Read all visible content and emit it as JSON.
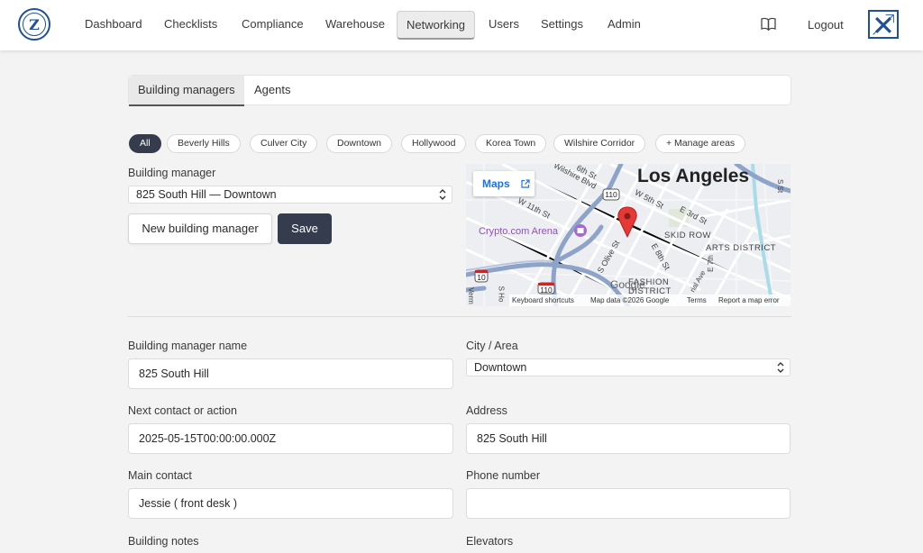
{
  "nav": {
    "logo_letter": "Z",
    "items": [
      "Dashboard",
      "Checklists",
      "Compliance",
      "Warehouse",
      "Networking",
      "Users",
      "Settings",
      "Admin"
    ],
    "active": "Networking",
    "logout": "Logout",
    "docs_icon": "book-icon",
    "brand_icon": "x-logo-icon"
  },
  "tabs": {
    "building_managers": "Building managers",
    "agents": "Agents",
    "active": "Building managers"
  },
  "chips": [
    "All",
    "Beverly Hills",
    "Culver City",
    "Downtown",
    "Hollywood",
    "Korea Town",
    "Wilshire Corridor",
    "+ Manage areas"
  ],
  "chips_active": "All",
  "selector": {
    "label": "Building manager",
    "value": "825 South Hill — Downtown",
    "new_button": "New building manager",
    "save_button": "Save"
  },
  "map": {
    "maps_button": "Maps",
    "city": "Los Angeles",
    "labels": {
      "wilshire": "Wilshire Blvd",
      "sixth": "6th St",
      "w5th": "W 5th St",
      "w11th": "W 11th St",
      "e3rd": "E 3rd St",
      "crypto": "Crypto.com Arena",
      "skid": "SKID ROW",
      "arts": "ARTS DISTRICT",
      "olive": "S Olive St",
      "e8th": "E 8th St",
      "fashion1": "FASHION",
      "fashion2": "DISTRICT",
      "r110": "110",
      "r10": "10",
      "google": "Google",
      "sho": "S Ho",
      "verm": "Verm",
      "e7th": "E 7th",
      "rial": "rial Ave",
      "sst": "S St"
    },
    "footer": {
      "shortcuts": "Keyboard shortcuts",
      "data": "Map data ©2026 Google",
      "terms": "Terms",
      "report": "Report a map error"
    },
    "colors": {
      "pin": "#e53935",
      "highway": "#8ea3c8",
      "water": "#9ed7e8",
      "park": "#d4e8cf"
    }
  },
  "form": {
    "name_label": "Building manager name",
    "name_value": "825 South Hill",
    "city_label": "City / Area",
    "city_value": "Downtown",
    "next_label": "Next contact or action",
    "next_value": "2025-05-15T00:00:00.000Z",
    "address_label": "Address",
    "address_value": "825 South Hill",
    "contact_label": "Main contact",
    "contact_value": "Jessie ( front desk )",
    "phone_label": "Phone number",
    "phone_value": "",
    "notes_label": "Building notes",
    "elevators_label": "Elevators"
  }
}
